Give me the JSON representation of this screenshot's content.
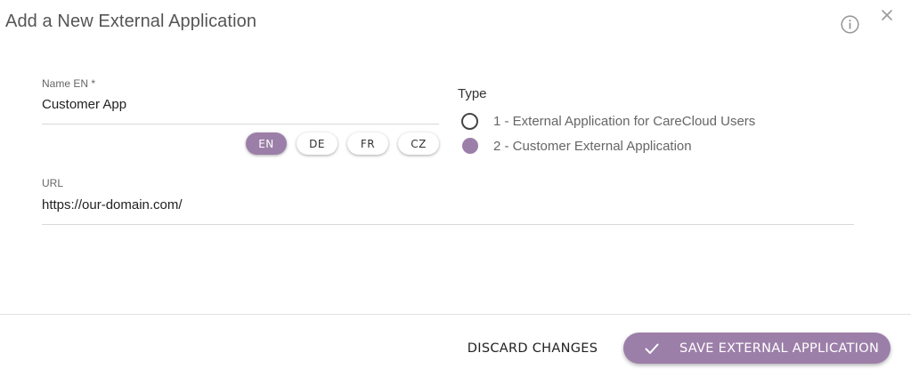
{
  "dialog": {
    "title": "Add a New External Application"
  },
  "icons": {
    "info": "info-icon",
    "close": "close-icon",
    "check": "check-icon"
  },
  "name_field": {
    "label": "Name EN *",
    "value": "Customer App"
  },
  "languages": [
    {
      "code": "EN",
      "active": true
    },
    {
      "code": "DE",
      "active": false
    },
    {
      "code": "FR",
      "active": false
    },
    {
      "code": "CZ",
      "active": false
    }
  ],
  "type": {
    "title": "Type",
    "options": [
      {
        "label": "1 - External Application for CareCloud Users",
        "selected": false
      },
      {
        "label": "2 - Customer External Application",
        "selected": true
      }
    ]
  },
  "url_field": {
    "label": "URL",
    "value": "https://our-domain.com/"
  },
  "footer": {
    "discard_label": "DISCARD CHANGES",
    "save_label": "SAVE EXTERNAL APPLICATION"
  },
  "colors": {
    "accent": "#9c7fa8"
  }
}
